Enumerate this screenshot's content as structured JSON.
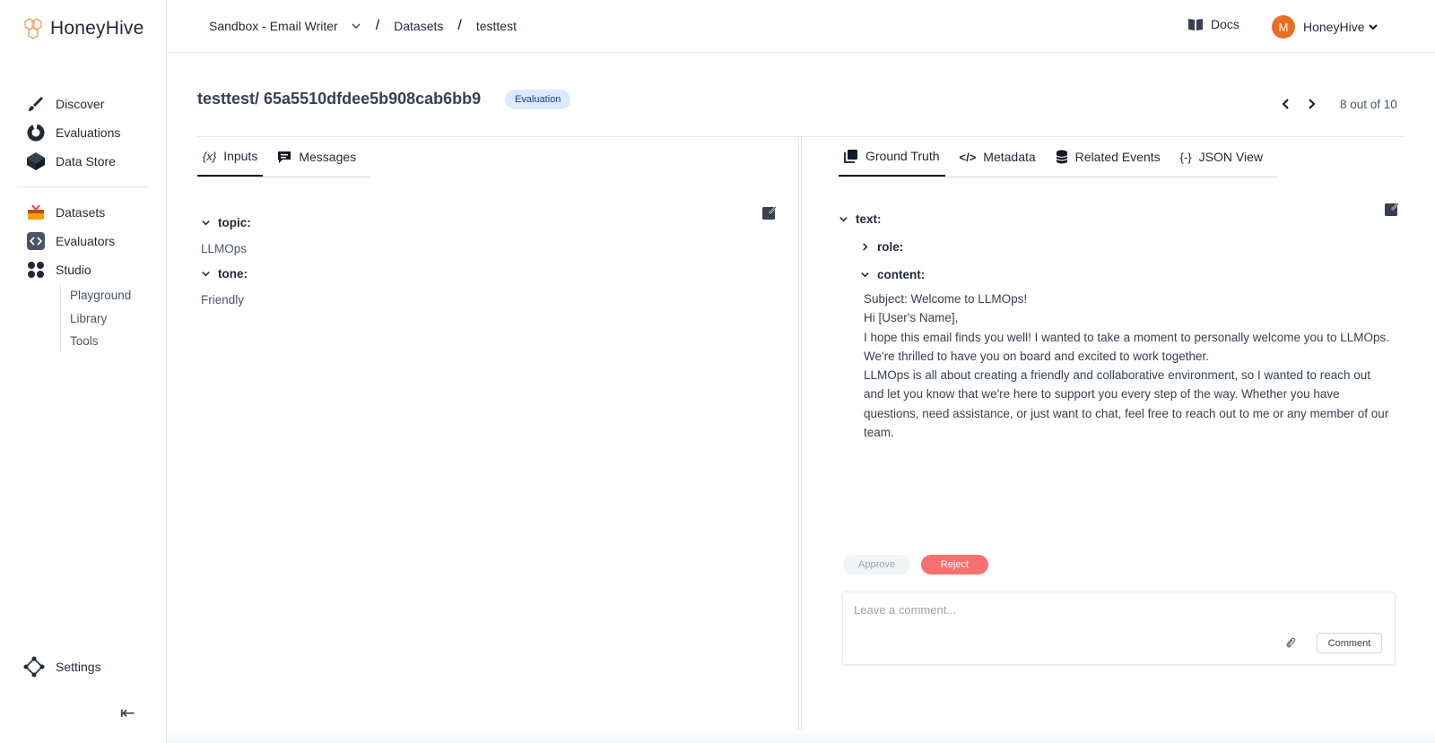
{
  "app": {
    "name": "HoneyHive"
  },
  "sidebar": {
    "items": [
      {
        "label": "Discover",
        "icon": "brush-icon"
      },
      {
        "label": "Evaluations",
        "icon": "donut-chart-icon"
      },
      {
        "label": "Data Store",
        "icon": "cube-icon"
      }
    ],
    "items2": [
      {
        "label": "Datasets",
        "icon": "inbox-tray-icon"
      },
      {
        "label": "Evaluators",
        "icon": "code-square-icon"
      },
      {
        "label": "Studio",
        "icon": "grid-dots-icon"
      }
    ],
    "studio_sub": [
      "Playground",
      "Library",
      "Tools"
    ],
    "settings_label": "Settings"
  },
  "header": {
    "breadcrumbs": [
      "Sandbox - Email Writer",
      "Datasets",
      "testtest"
    ],
    "docs_label": "Docs",
    "user_initial": "M",
    "user_name": "HoneyHive"
  },
  "page": {
    "title": "testtest/ 65a5510dfdee5b908cab6bb9",
    "badge": "Evaluation",
    "pager": "8 out of 10"
  },
  "left_panel": {
    "tabs": [
      {
        "label": "Inputs",
        "icon": "variable-icon",
        "active": true
      },
      {
        "label": "Messages",
        "icon": "chat-bubble-icon",
        "active": false
      }
    ],
    "fields": [
      {
        "key": "topic:",
        "value": "LLMOps"
      },
      {
        "key": "tone:",
        "value": "Friendly"
      }
    ]
  },
  "right_panel": {
    "tabs": [
      {
        "label": "Ground Truth",
        "icon": "layers-icon",
        "active": true
      },
      {
        "label": "Metadata",
        "icon": "code-icon",
        "active": false
      },
      {
        "label": "Related Events",
        "icon": "database-icon",
        "active": false
      },
      {
        "label": "JSON View",
        "icon": "braces-icon",
        "active": false
      }
    ],
    "root_key": "text:",
    "role_key": "role:",
    "content_key": "content:",
    "content_lines": [
      "Subject: Welcome to LLMOps!",
      "Hi [User's Name],",
      "I hope this email finds you well! I wanted to take a moment to personally welcome you to LLMOps. We're thrilled to have you on board and excited to work together.",
      "LLMOps is all about creating a friendly and collaborative environment, so I wanted to reach out and let you know that we're here to support you every step of the way. Whether you have questions, need assistance, or just want to chat, feel free to reach out to me or any member of our team."
    ],
    "approve_label": "Approve",
    "reject_label": "Reject",
    "comment_placeholder": "Leave a comment...",
    "comment_button": "Comment"
  },
  "colors": {
    "accent_orange": "#ea6d23",
    "reject_red": "#f87171",
    "badge_bg": "#dbeafe"
  }
}
